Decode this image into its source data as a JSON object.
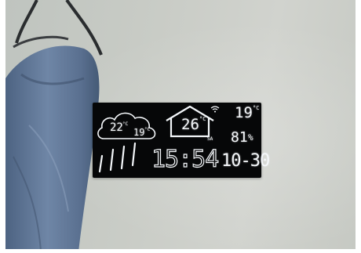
{
  "weather_station": {
    "forecast_high_temp": "22",
    "forecast_high_unit": "°C",
    "forecast_low_temp": "19",
    "forecast_low_unit": "°C",
    "forecast_icon": "rain-cloud-icon",
    "indoor_temp": "26",
    "indoor_unit": "°C",
    "day_label": "SA",
    "outdoor_temp": "19",
    "outdoor_unit": "°C",
    "humidity_value": "81",
    "humidity_unit": "%",
    "time": "15:54",
    "date": "10-30"
  },
  "colors": {
    "lcd_background": "#060708",
    "segment": "#f4f7fa",
    "wall": "#c9ccc6",
    "denim": "#5e7392"
  }
}
